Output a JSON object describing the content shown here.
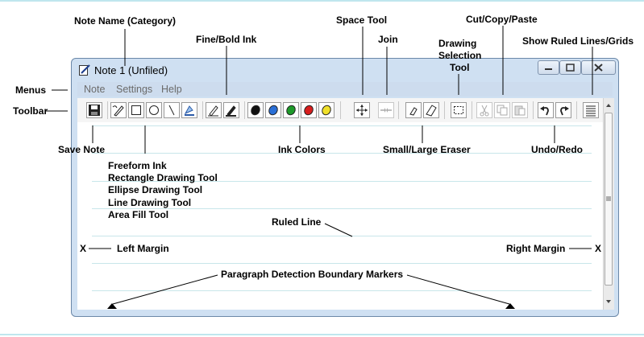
{
  "window": {
    "title": "Note 1 (Unfiled)"
  },
  "menus": [
    "Note",
    "Settings",
    "Help"
  ],
  "toolbar": {
    "buttons": [
      "save-icon",
      "freeform-ink-icon",
      "rectangle-icon",
      "ellipse-icon",
      "line-icon",
      "area-fill-icon",
      "fine-ink-icon",
      "bold-ink-icon",
      "ink-black-icon",
      "ink-blue-icon",
      "ink-green-icon",
      "ink-red-icon",
      "ink-yellow-icon",
      "space-tool-icon",
      "join-icon",
      "small-eraser-icon",
      "large-eraser-icon",
      "selection-tool-icon",
      "cut-icon",
      "copy-icon",
      "paste-icon",
      "undo-icon",
      "redo-icon",
      "ruled-lines-icon"
    ],
    "ink_colors": [
      "#111111",
      "#2a6fd6",
      "#1e9a2a",
      "#d81e1e",
      "#f0e02a"
    ]
  },
  "annotations": {
    "note_name": "Note Name (Category)",
    "menus": "Menus",
    "toolbar": "Toolbar",
    "fine_bold_ink": "Fine/Bold Ink",
    "space_tool": "Space Tool",
    "join": "Join",
    "drawing_selection_tool": [
      "Drawing",
      "Selection",
      "Tool"
    ],
    "cut_copy_paste": "Cut/Copy/Paste",
    "show_ruled_lines": "Show Ruled Lines/Grids",
    "save_note": "Save Note",
    "ink_colors": "Ink Colors",
    "small_large_eraser": "Small/Large Eraser",
    "undo_redo": "Undo/Redo",
    "drawing_tools": [
      "Freeform Ink",
      "Rectangle Drawing Tool",
      "Ellipse Drawing Tool",
      "Line Drawing Tool",
      "Area Fill Tool"
    ],
    "ruled_line": "Ruled Line",
    "left_x": "X",
    "left_margin": "Left Margin",
    "right_margin": "Right Margin",
    "right_x": "X",
    "paragraph_markers": "Paragraph Detection Boundary Markers"
  }
}
